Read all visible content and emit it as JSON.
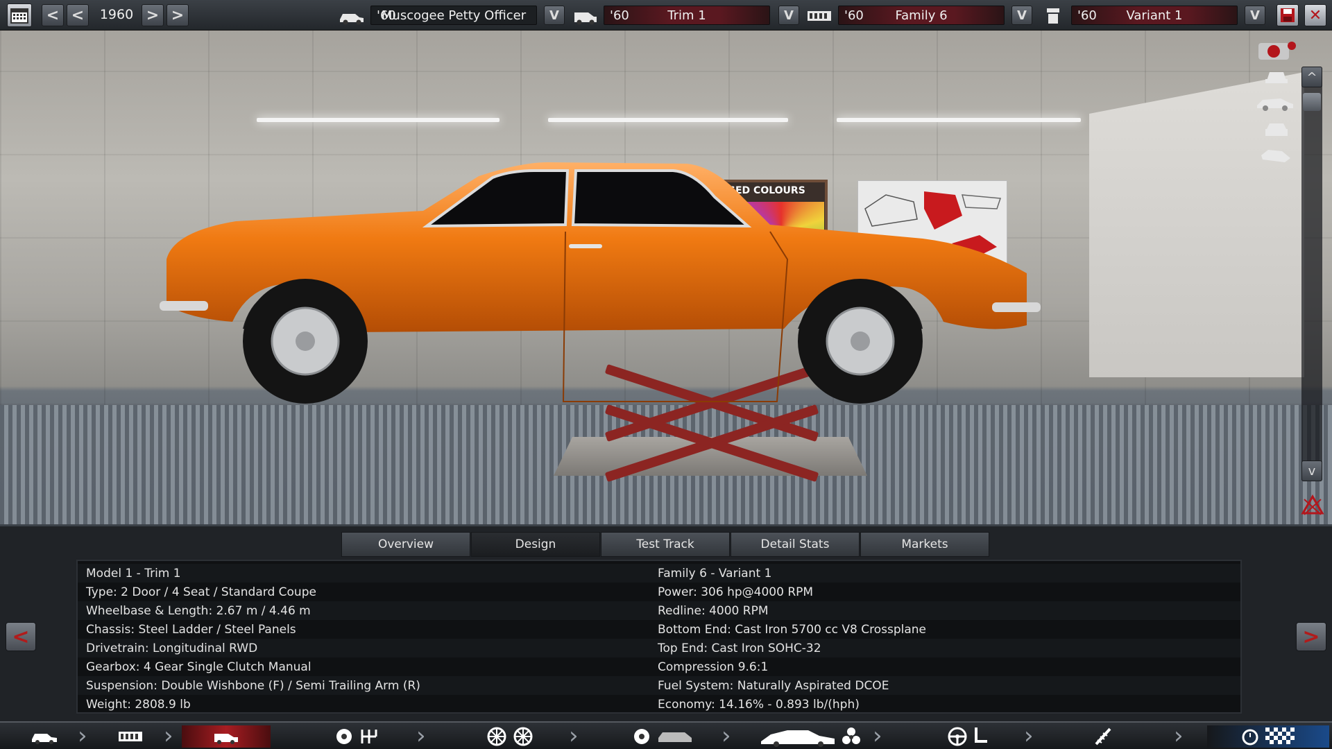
{
  "topbar": {
    "year": "1960",
    "model": {
      "year_tag": "'60",
      "name": "Muscogee Petty Officer"
    },
    "trim": {
      "year_tag": "'60",
      "name": "Trim 1"
    },
    "family": {
      "year_tag": "'60",
      "name": "Family 6"
    },
    "variant": {
      "year_tag": "'60",
      "name": "Variant 1"
    },
    "dropdown_label": "V",
    "prev_label": "<",
    "next_label": ">"
  },
  "viewport": {
    "colour_board_header": "OSED COLOURS",
    "car_color": "#f07a12"
  },
  "tabs": [
    {
      "label": "Overview"
    },
    {
      "label": "Design"
    },
    {
      "label": "Test Track"
    },
    {
      "label": "Detail Stats"
    },
    {
      "label": "Markets"
    }
  ],
  "active_tab": "Design",
  "info": {
    "left": [
      "Model 1 - Trim 1",
      "Type: 2 Door / 4 Seat / Standard Coupe",
      "Wheelbase & Length: 2.67 m / 4.46 m",
      "Chassis: Steel Ladder / Steel Panels",
      "Drivetrain: Longitudinal RWD",
      "Gearbox: 4 Gear Single Clutch Manual",
      "Suspension: Double Wishbone (F) / Semi Trailing Arm (R)",
      "Weight: 2808.9 lb"
    ],
    "right": [
      "Family 6 - Variant 1",
      "Power: 306 hp@4000 RPM",
      "Redline: 4000 RPM",
      "Bottom End: Cast Iron 5700 cc V8 Crossplane",
      "Top End: Cast Iron SOHC-32",
      "Compression 9.6:1",
      "Fuel System: Naturally Aspirated DCOE",
      "Economy: 14.16% - 0.893 lb/(hph)"
    ]
  },
  "side_nav": {
    "left_label": "<",
    "right_label": ">"
  },
  "scroll": {
    "up_label": "^",
    "down_label": "v"
  },
  "colors": {
    "accent_red": "#a81d22",
    "panel_bg": "#202327"
  }
}
